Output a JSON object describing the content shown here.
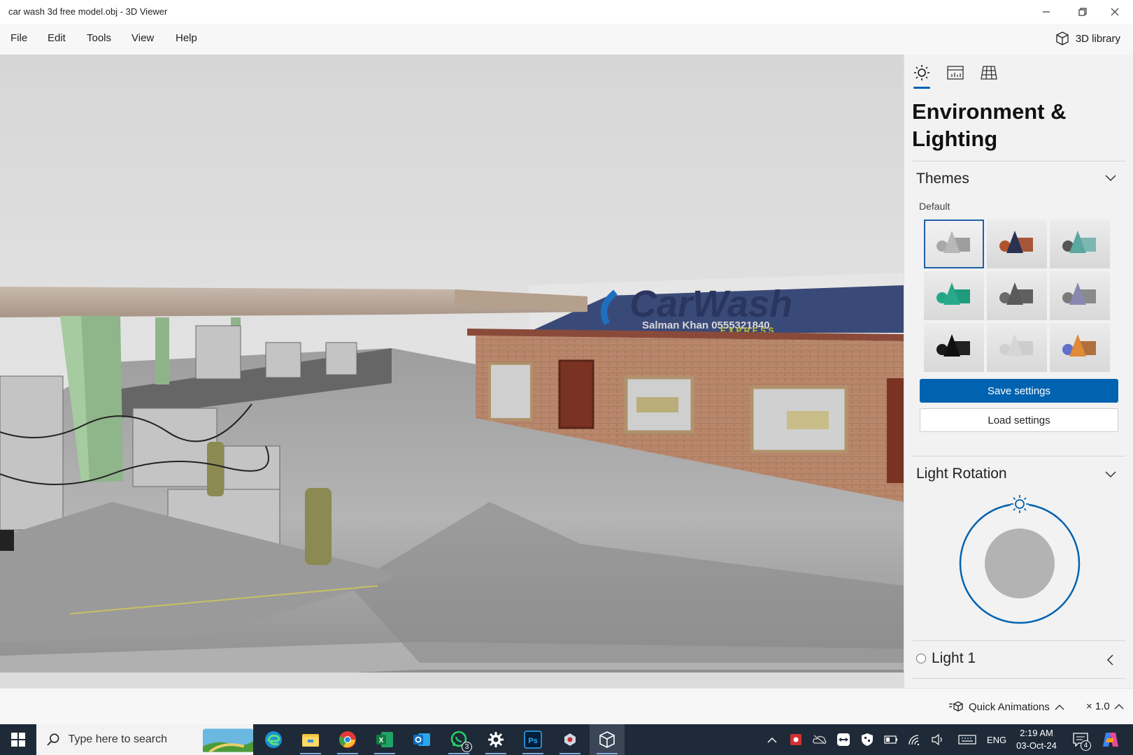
{
  "window": {
    "title": "car wash 3d free model.obj - 3D Viewer",
    "controls": [
      "minimize-icon",
      "restore-icon",
      "close-icon"
    ]
  },
  "menu": {
    "items": [
      "File",
      "Edit",
      "Tools",
      "View",
      "Help"
    ],
    "library_label": "3D library"
  },
  "viewport": {
    "sign_text": "CarWash",
    "sign_subtext": "Salman Khan 0555321840",
    "sign_tagline": "E X P R E S S"
  },
  "panel": {
    "tabs": [
      "sun-icon",
      "stats-icon",
      "grid-icon"
    ],
    "active_tab": 0,
    "title": "Environment & Lighting",
    "themes": {
      "heading": "Themes",
      "group_label": "Default",
      "selected_index": 0,
      "items": [
        {
          "cone": "#b8b8b8",
          "sphere": "#a8a8a8",
          "cube": "#9e9e9e"
        },
        {
          "cone": "#2b3150",
          "sphere": "#b0532a",
          "cube": "#a8563a"
        },
        {
          "cone": "#5aa8a0",
          "sphere": "#555555",
          "cube": "#7cb8b0"
        },
        {
          "cone": "#2aa88a",
          "sphere": "#23a887",
          "cube": "#1f9a7d"
        },
        {
          "cone": "#5a5a5a",
          "sphere": "#6a6a6a",
          "cube": "#606060"
        },
        {
          "cone": "#8a88b0",
          "sphere": "#7a7a7a",
          "cube": "#8a8a8a"
        },
        {
          "cone": "#111111",
          "sphere": "#1a1a1a",
          "cube": "#222222"
        },
        {
          "cone": "#d6d6d6",
          "sphere": "#d0d0d0",
          "cube": "#cdcdcd"
        },
        {
          "cone": "#e08a3a",
          "sphere": "#6070c8",
          "cube": "#b0703c"
        }
      ]
    },
    "save_label": "Save settings",
    "load_label": "Load settings",
    "rotation": {
      "heading": "Light Rotation"
    },
    "light": {
      "label": "Light 1"
    }
  },
  "status": {
    "animations_label": "Quick Animations",
    "speed_label": "× 1.0"
  },
  "taskbar": {
    "search_placeholder": "Type here to search",
    "apps": [
      "edge-icon",
      "file-explorer-icon",
      "chrome-icon",
      "excel-icon",
      "outlook-icon",
      "whatsapp-icon",
      "settings-icon",
      "photoshop-icon",
      "app-icon",
      "3d-viewer-icon"
    ],
    "whatsapp_badge": "3",
    "language": "ENG",
    "time": "2:19 AM",
    "date": "03-Oct-24",
    "notifications_badge": "4"
  },
  "colors": {
    "accent": "#0063b1",
    "taskbar_bg": "#1e2a38",
    "panel_bg": "#f2f2f2"
  }
}
